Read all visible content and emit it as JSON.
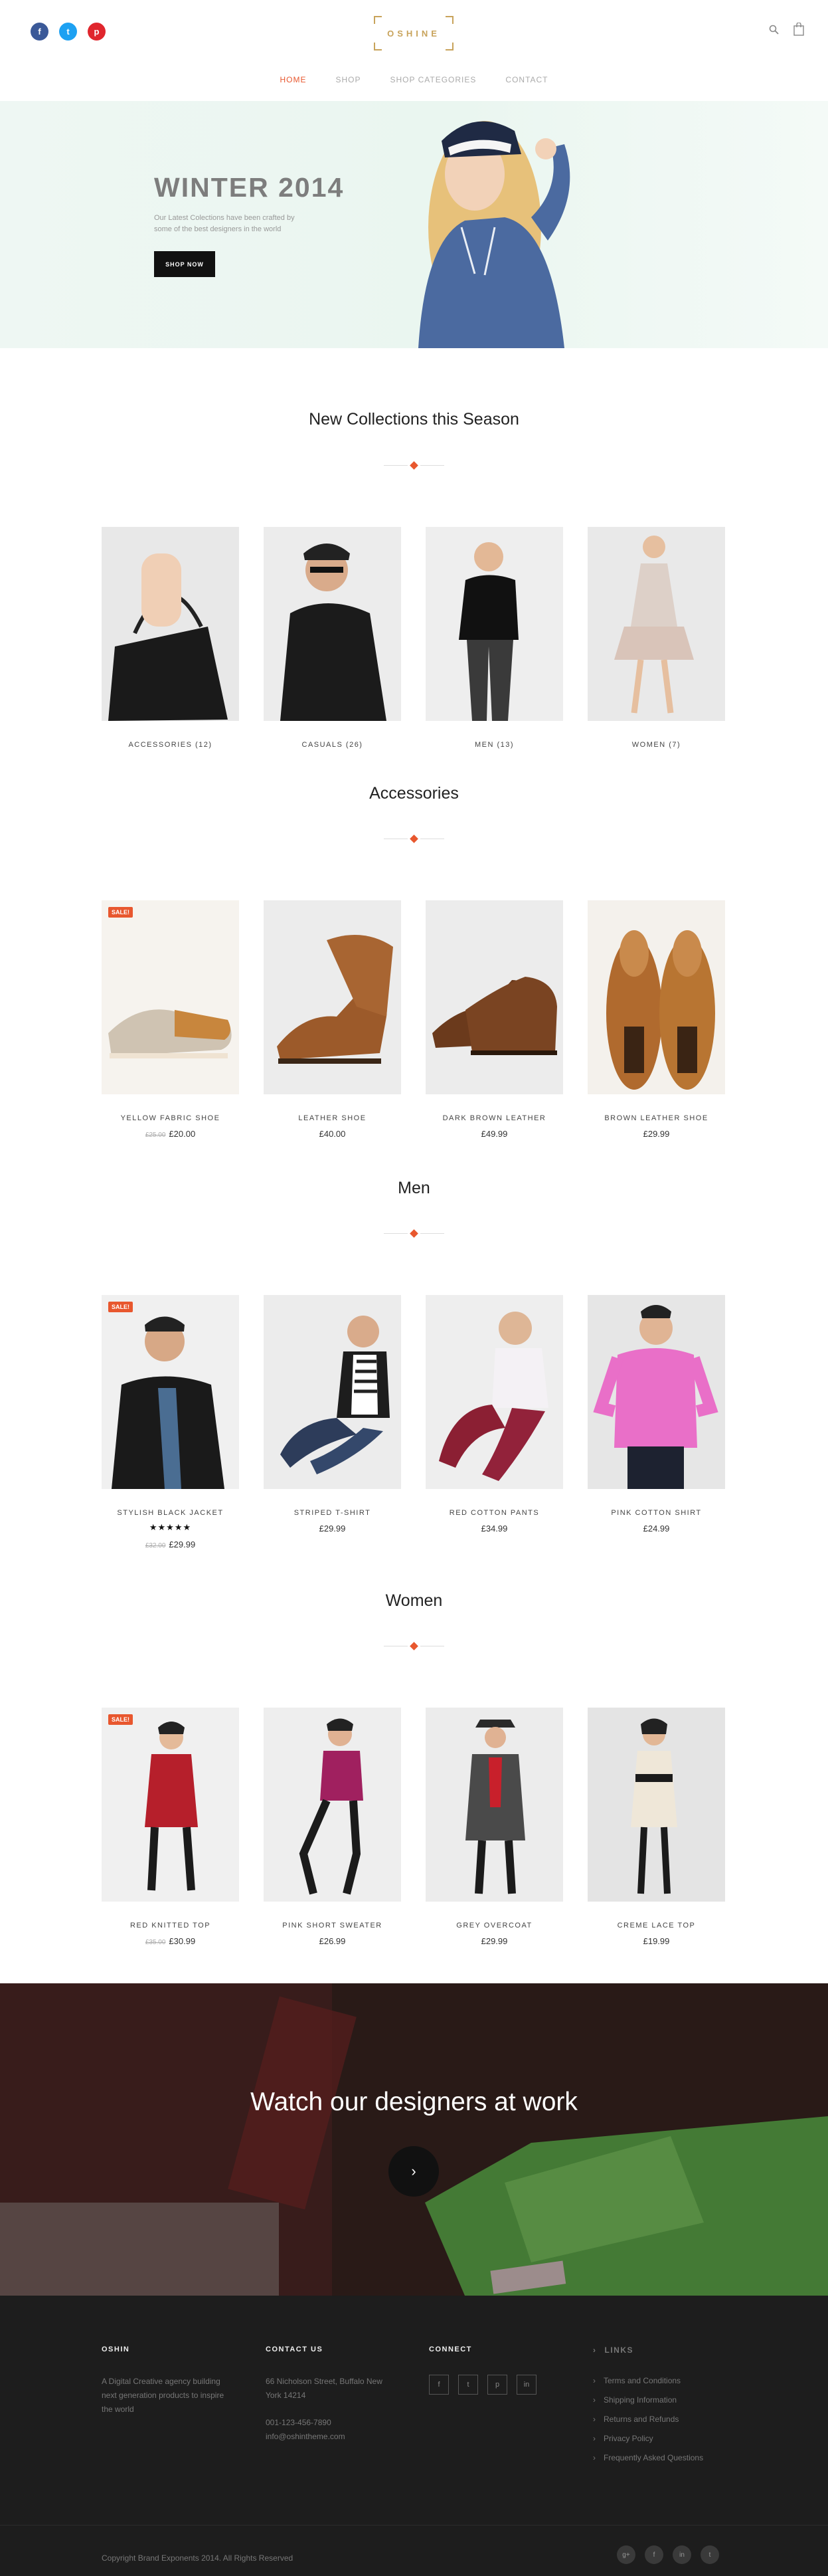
{
  "header": {
    "social": [
      {
        "name": "facebook",
        "glyph": "f"
      },
      {
        "name": "twitter",
        "glyph": "t"
      },
      {
        "name": "pinterest",
        "glyph": "p"
      }
    ],
    "logo": "OSHINE",
    "nav": [
      "HOME",
      "SHOP",
      "SHOP CATEGORIES",
      "CONTACT"
    ],
    "active_nav": "HOME"
  },
  "hero": {
    "title": "WINTER 2014",
    "text": "Our Latest Colections have been crafted by some of the best designers in the world",
    "button": "SHOP NOW"
  },
  "collections": {
    "title": "New Collections this Season",
    "items": [
      {
        "label": "ACCESSORIES (12)"
      },
      {
        "label": "CASUALS (26)"
      },
      {
        "label": "MEN (13)"
      },
      {
        "label": "WOMEN (7)"
      }
    ]
  },
  "accessories": {
    "title": "Accessories",
    "items": [
      {
        "label": "YELLOW FABRIC SHOE",
        "old_price": "£25.00",
        "price": "£20.00",
        "sale": "SALE!"
      },
      {
        "label": "LEATHER SHOE",
        "old_price": "",
        "price": "£40.00",
        "sale": ""
      },
      {
        "label": "DARK BROWN LEATHER",
        "old_price": "",
        "price": "£49.99",
        "sale": ""
      },
      {
        "label": "BROWN LEATHER SHOE",
        "old_price": "",
        "price": "£29.99",
        "sale": ""
      }
    ]
  },
  "men": {
    "title": "Men",
    "items": [
      {
        "label": "STYLISH BLACK JACKET",
        "old_price": "£32.00",
        "price": "£29.99",
        "sale": "SALE!",
        "stars": "★★★★★"
      },
      {
        "label": "STRIPED T-SHIRT",
        "old_price": "",
        "price": "£29.99",
        "sale": ""
      },
      {
        "label": "RED COTTON PANTS",
        "old_price": "",
        "price": "£34.99",
        "sale": ""
      },
      {
        "label": "PINK COTTON SHIRT",
        "old_price": "",
        "price": "£24.99",
        "sale": ""
      }
    ]
  },
  "women": {
    "title": "Women",
    "items": [
      {
        "label": "RED KNITTED TOP",
        "old_price": "£35.00",
        "price": "£30.99",
        "sale": "SALE!"
      },
      {
        "label": "PINK SHORT SWEATER",
        "old_price": "",
        "price": "£26.99",
        "sale": ""
      },
      {
        "label": "GREY OVERCOAT",
        "old_price": "",
        "price": "£29.99",
        "sale": ""
      },
      {
        "label": "CREME LACE TOP",
        "old_price": "",
        "price": "£19.99",
        "sale": ""
      }
    ]
  },
  "video": {
    "title": "Watch our designers at work",
    "play": "›"
  },
  "footer": {
    "col1": {
      "title": "OSHIN",
      "text": "A Digital Creative agency building next generation products to inspire the world"
    },
    "col2": {
      "title": "CONTACT US",
      "address": "66 Nicholson Street, Buffalo New York 14214",
      "phone": "001-123-456-7890",
      "email": "info@oshintheme.com"
    },
    "col3": {
      "title": "CONNECT",
      "icons": [
        "f",
        "t",
        "p",
        "in"
      ]
    },
    "col4": {
      "title": "LINKS",
      "links": [
        "Terms and Conditions",
        "Shipping Information",
        "Returns and Refunds",
        "Privacy Policy",
        "Frequently Asked Questions"
      ]
    },
    "copyright": "Copyright Brand Exponents 2014. All Rights Reserved",
    "bottom_icons": [
      "g+",
      "f",
      "in",
      "t"
    ]
  }
}
